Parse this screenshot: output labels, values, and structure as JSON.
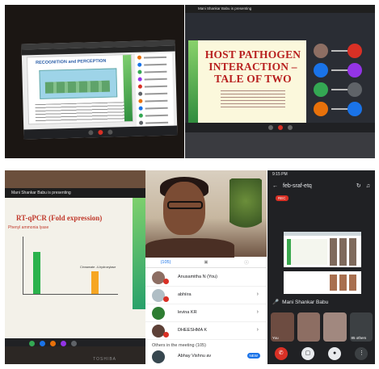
{
  "panel1": {
    "slide_title": "RECOGNITION and PERCEPTION"
  },
  "panel2": {
    "presenting": "Mani Shankar Babu is presenting",
    "slide_title": "HOST PATHOGEN INTERACTION – TALE OF TWO"
  },
  "panel3": {
    "presenting": "Mani Shankar Babu is presenting",
    "slide_heading": "RT-qPCR (Fold expression)",
    "chart_label": "Phenyl ammonia lyase",
    "bar_note": "Cinnamate -4-hydroxylase",
    "brand": "TOSHIBA"
  },
  "panel4": {
    "tabs": [
      "(105)",
      "",
      ""
    ],
    "participants": [
      {
        "name": "Anusamitha N (You)"
      },
      {
        "name": "abhiira"
      },
      {
        "name": "levina KR"
      },
      {
        "name": "DHEESHMA K"
      }
    ],
    "others_label": "Others in the meeting (105)",
    "last_name": "Abhay Vishnu av",
    "new_badge": "NEW"
  },
  "panel5": {
    "time": "9:15 PM",
    "meeting_code": "feb-sraf-etq",
    "rec_label": "REC",
    "presenter": "Mani Shankar Babu",
    "tile_you": "You",
    "tile_others": "85 others"
  },
  "colors": {
    "meet_dark": "#202124",
    "end_red": "#d93025",
    "slide_red": "#b8201f",
    "slide_green": "#2e8b3d"
  }
}
